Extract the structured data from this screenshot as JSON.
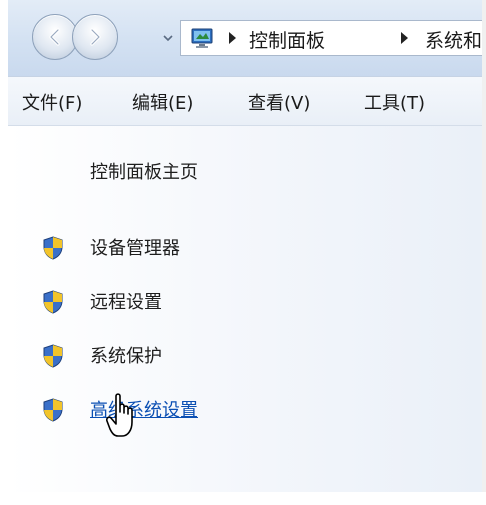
{
  "navigation": {
    "back_icon": "back-arrow-icon",
    "forward_icon": "forward-arrow-icon",
    "recent_icon": "chevron-down-icon"
  },
  "address_bar": {
    "location_icon": "computer-icon",
    "breadcrumbs": [
      "控制面板",
      "系统和"
    ]
  },
  "menu": {
    "items": [
      "文件(F)",
      "编辑(E)",
      "查看(V)",
      "工具(T)"
    ]
  },
  "left_pane": {
    "home_link": "控制面板主页",
    "links": [
      {
        "label": "设备管理器",
        "icon": "uac-shield-icon"
      },
      {
        "label": "远程设置",
        "icon": "uac-shield-icon"
      },
      {
        "label": "系统保护",
        "icon": "uac-shield-icon"
      },
      {
        "label": "高级系统设置",
        "icon": "uac-shield-icon"
      }
    ]
  },
  "colors": {
    "link_hover": "#0b4fb3",
    "nav_gradient_top": "#e3ecf7",
    "nav_gradient_bottom": "#c9d9ee"
  }
}
